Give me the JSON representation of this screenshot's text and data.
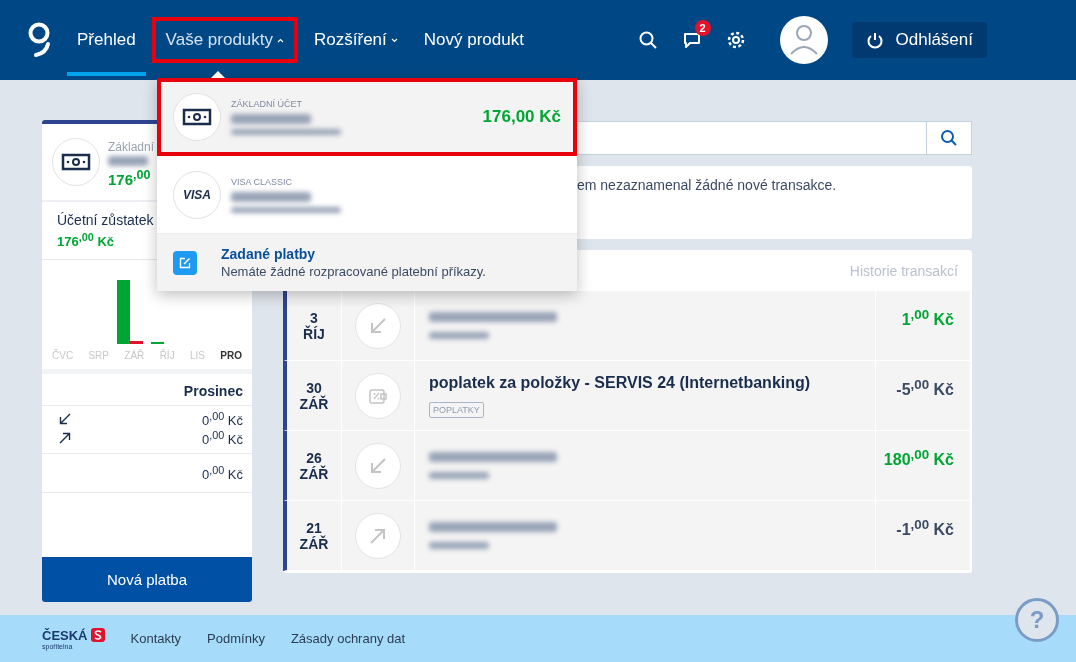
{
  "nav": {
    "items": [
      {
        "label": "Přehled",
        "selected": true,
        "dropdown": false,
        "open": false,
        "annotated": false
      },
      {
        "label": "Vaše produkty",
        "selected": false,
        "dropdown": true,
        "open": true,
        "annotated": true
      },
      {
        "label": "Rozšíření",
        "selected": false,
        "dropdown": true,
        "open": false,
        "annotated": false
      },
      {
        "label": "Nový produkt",
        "selected": false,
        "dropdown": false,
        "open": false,
        "annotated": false
      }
    ],
    "notifications": "2",
    "logout": "Odhlášení"
  },
  "dropdown": {
    "products": [
      {
        "kind": "account",
        "type": "ZÁKLADNÍ ÚČET",
        "amount": "176,00 Kč",
        "annotated": true
      },
      {
        "kind": "card",
        "type": "VISA CLASSIC",
        "icon_text": "VISA",
        "annotated": false
      }
    ],
    "pending": {
      "title": "Zadané platby",
      "text": "Nemáte žádné rozpracované platební příkazy."
    }
  },
  "sidebar": {
    "product_type": "Základní",
    "balance": "176$^{,00}$",
    "balance_label": "Účetní zůstatek",
    "balance_value": "176$^{,00}$ Kč",
    "months": [
      {
        "label": "ČVC",
        "selected": false
      },
      {
        "label": "SRP",
        "selected": false
      },
      {
        "label": "ZÁŘ",
        "selected": false
      },
      {
        "label": "ŘÍJ",
        "selected": false
      },
      {
        "label": "LIS",
        "selected": false
      },
      {
        "label": "PRO",
        "selected": true
      }
    ],
    "month_title": "Prosinec",
    "incoming": "0$^{,00}$ Kč",
    "outgoing": "0$^{,00}$ Kč",
    "total": "0$^{,00}$ Kč",
    "button": "Nová platba"
  },
  "info": {
    "text": "em nezaznamenal žádné nové transakce."
  },
  "transactions": {
    "header": "Historie transakcí",
    "rows": [
      {
        "day": "3",
        "month": "ŘÍJ",
        "kind": "in",
        "amount": "1$^{,00}$ Kč",
        "positive": true
      },
      {
        "day": "30",
        "month": "ZÁŘ",
        "kind": "fee",
        "title": "poplatek za položky - SERVIS 24 (Internetbanking)",
        "tag": "POPLATKY",
        "amount": "-5$^{,00}$ Kč",
        "positive": false
      },
      {
        "day": "26",
        "month": "ZÁŘ",
        "kind": "in",
        "amount": "180$^{,00}$ Kč",
        "positive": true
      },
      {
        "day": "21",
        "month": "ZÁŘ",
        "kind": "out",
        "amount": "-1$^{,00}$ Kč",
        "positive": false
      }
    ]
  },
  "footer": {
    "logo": "ČESKÁ",
    "logo_sub": "spořitelna",
    "links": [
      "Kontakty",
      "Podmínky",
      "Zásady ochrany dat"
    ],
    "help": "?"
  }
}
